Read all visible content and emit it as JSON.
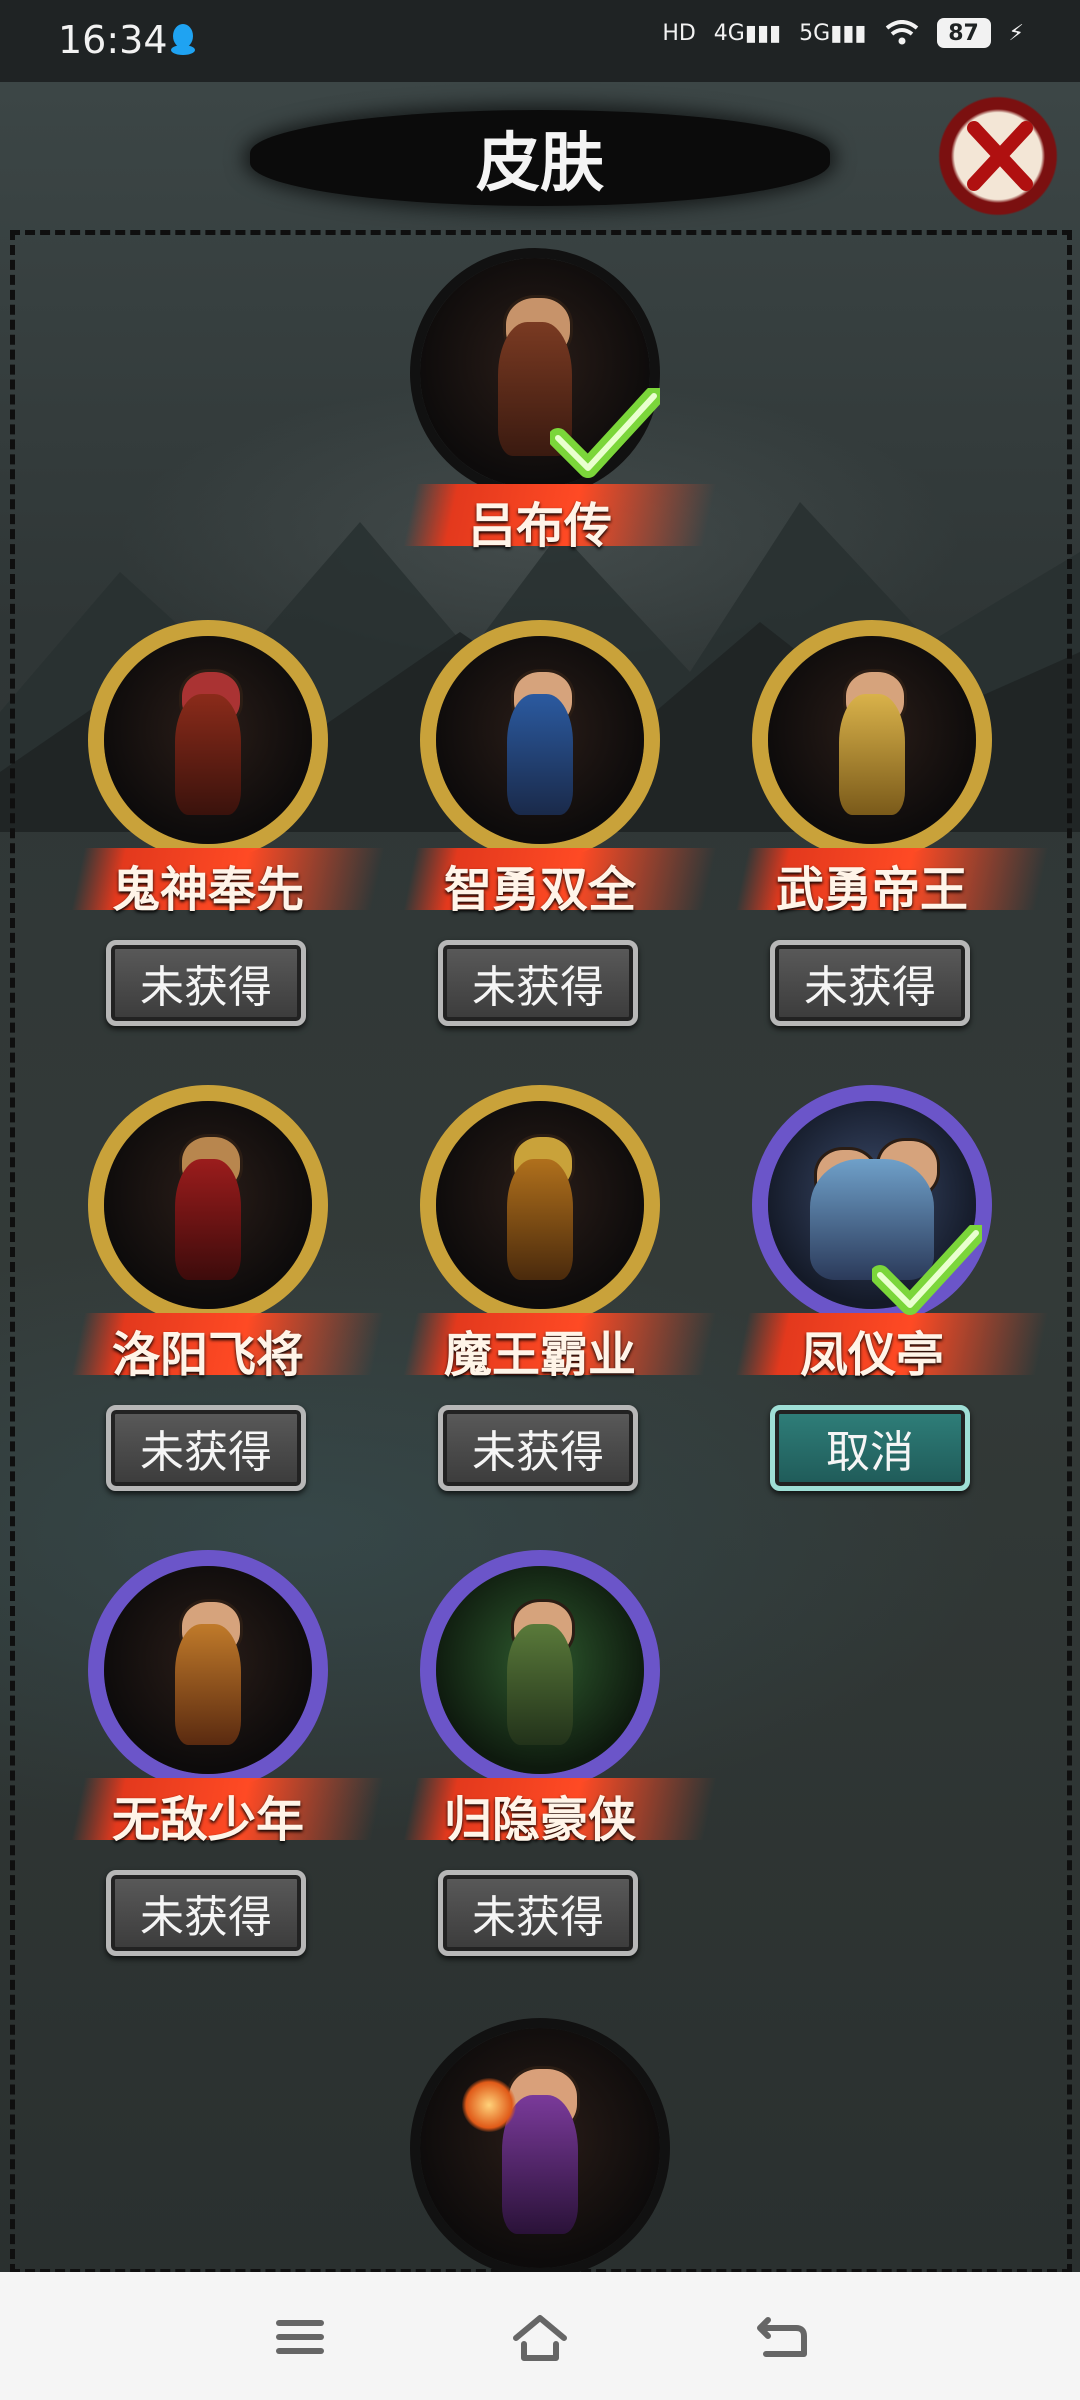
{
  "status_bar": {
    "time": "16:34",
    "network_icons": [
      "hd-icon",
      "4g-signal-icon",
      "5g-signal-icon",
      "wifi-icon"
    ],
    "battery": "87"
  },
  "header": {
    "title": "皮肤",
    "close_icon": "close-x-icon"
  },
  "skins": {
    "current": {
      "name": "吕布传",
      "selected": true
    },
    "list": [
      {
        "name": "鬼神奉先",
        "status": "未获得",
        "ring": "gold"
      },
      {
        "name": "智勇双全",
        "status": "未获得",
        "ring": "gold"
      },
      {
        "name": "武勇帝王",
        "status": "未获得",
        "ring": "gold"
      },
      {
        "name": "洛阳飞将",
        "status": "未获得",
        "ring": "gold"
      },
      {
        "name": "魔王霸业",
        "status": "未获得",
        "ring": "gold"
      },
      {
        "name": "凤仪亭",
        "status": "取消",
        "ring": "purple",
        "selected": true
      },
      {
        "name": "无敌少年",
        "status": "未获得",
        "ring": "purple"
      },
      {
        "name": "归隐豪侠",
        "status": "未获得",
        "ring": "purple"
      }
    ]
  },
  "colors": {
    "gold_ring": "#c9a23a",
    "purple_ring": "#6b55c9",
    "ribbon": "#ff4a24",
    "teal_button": "#2f7f7a",
    "check": "#7bd63a"
  },
  "navbar": {
    "icons": [
      "menu-icon",
      "home-icon",
      "back-icon"
    ]
  }
}
